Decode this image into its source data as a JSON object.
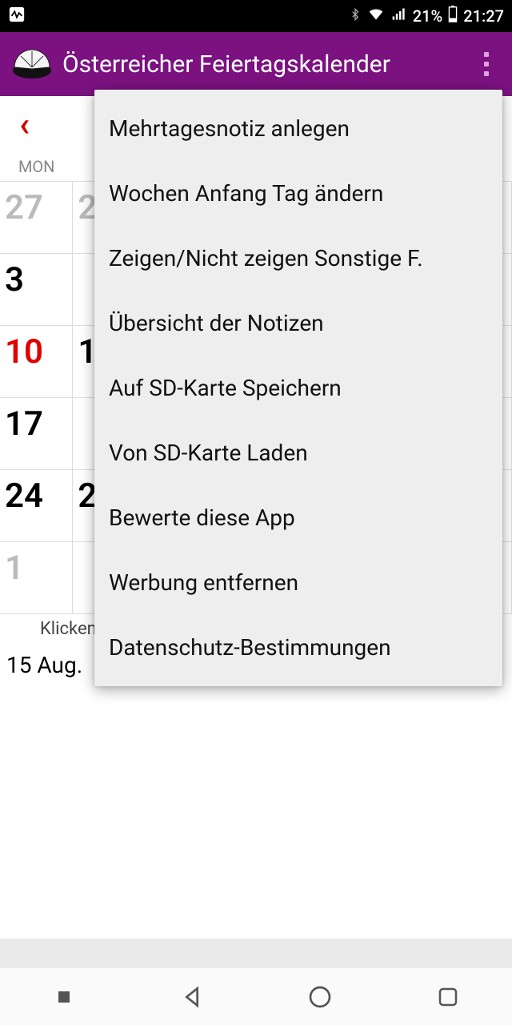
{
  "status_bar": {
    "battery_pct": "21%",
    "time": "21:27"
  },
  "app_bar": {
    "title": "Österreicher Feiertagskalender"
  },
  "calendar": {
    "dow_first": "MON",
    "rows": [
      {
        "first": "27",
        "second_peek": "2",
        "style": "muted"
      },
      {
        "first": "3",
        "second_peek": "",
        "style": ""
      },
      {
        "first": "10",
        "second_peek": "1",
        "style": "holiday"
      },
      {
        "first": "17",
        "second_peek": "",
        "style": ""
      },
      {
        "first": "24",
        "second_peek": "2",
        "style": ""
      },
      {
        "first": "1",
        "second_peek": "",
        "style": "muted"
      }
    ],
    "hint": "Klicken",
    "date_line": "15 Aug."
  },
  "menu": {
    "items": [
      "Mehrtagesnotiz anlegen",
      "Wochen Anfang Tag ändern",
      "Zeigen/Nicht zeigen Sonstige F.",
      "Übersicht der Notizen",
      "Auf SD-Karte Speichern",
      "Von SD-Karte Laden",
      "Bewerte diese App",
      "Werbung entfernen",
      "Datenschutz-Bestimmungen"
    ]
  }
}
